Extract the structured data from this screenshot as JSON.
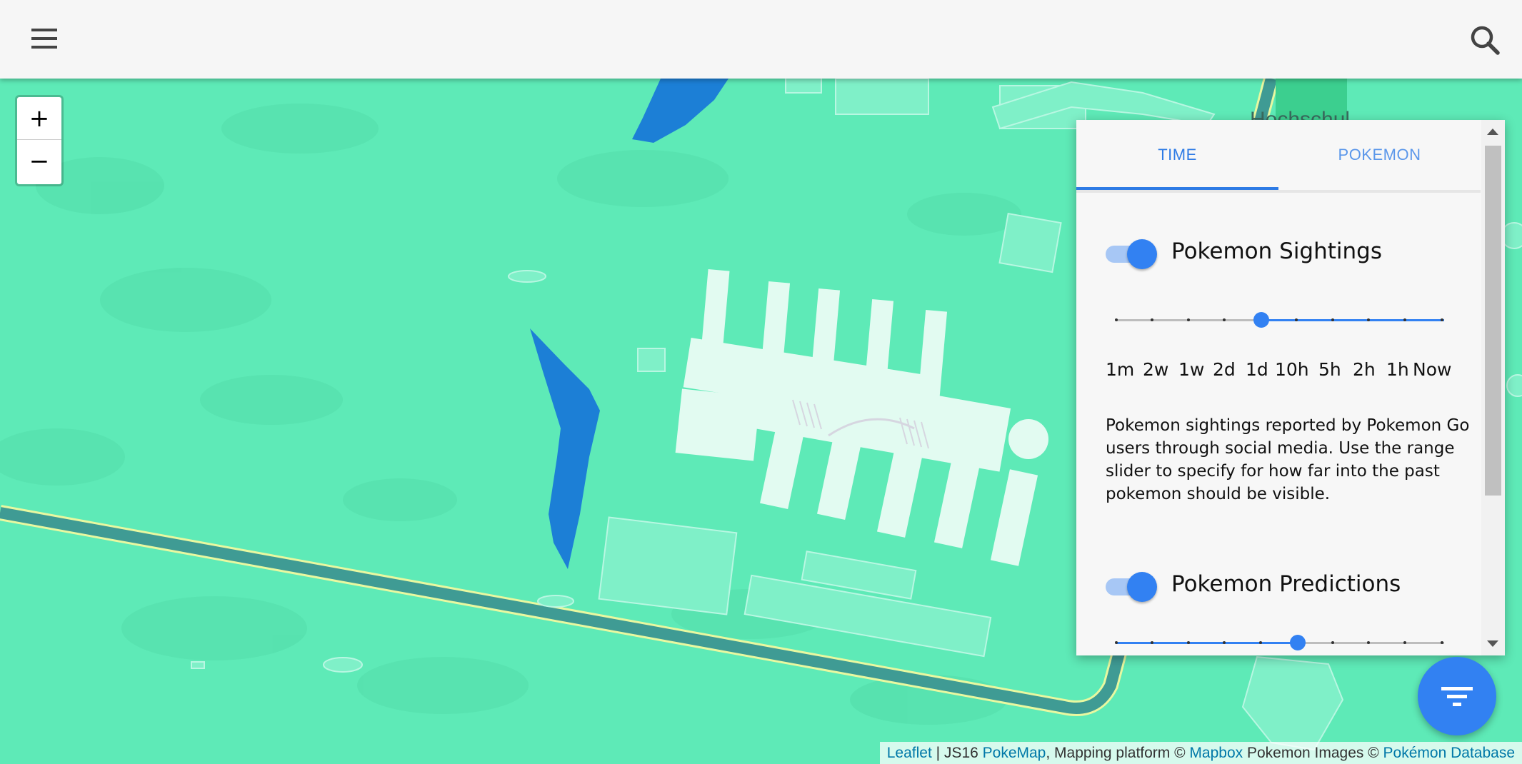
{
  "appbar": {
    "menu_icon": "hamburger-menu-icon",
    "search_icon": "search-icon"
  },
  "map": {
    "zoom_in_label": "+",
    "zoom_out_label": "−",
    "place_label": "Hochschul",
    "colors": {
      "land": "#5eeab7",
      "water": "#1c7fd6",
      "road": "#3f9b94"
    }
  },
  "panel": {
    "tabs": [
      {
        "label": "TIME",
        "active": true
      },
      {
        "label": "POKEMON",
        "active": false
      }
    ],
    "sightings": {
      "title": "Pokemon Sightings",
      "enabled": true,
      "range_labels": [
        "1m",
        "2w",
        "1w",
        "2d",
        "1d",
        "10h",
        "5h",
        "2h",
        "1h",
        "Now"
      ],
      "selected_start": "1d",
      "description": "Pokemon sightings reported by Pokemon Go users through social media. Use the range slider to specify for how far into the past pokemon should be visible."
    },
    "predictions": {
      "title": "Pokemon Predictions",
      "enabled": true,
      "selected_position": "10h"
    }
  },
  "fab": {
    "icon": "filter-icon"
  },
  "attribution": {
    "leaflet": "Leaflet",
    "sep1": " | JS16 ",
    "pokemap": "PokeMap",
    "mid": ", Mapping platform © ",
    "mapbox": "Mapbox",
    "images": " Pokemon Images © ",
    "pokedb": "Pokémon Database"
  },
  "accent_color": "#3281f2"
}
